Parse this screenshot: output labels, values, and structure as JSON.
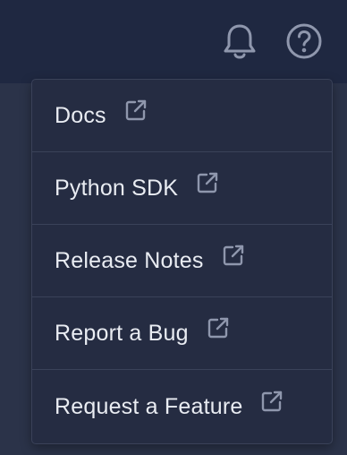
{
  "header": {
    "notifications_icon": "bell-icon",
    "help_icon": "help-circle-icon"
  },
  "colors": {
    "topbar": "#1f2841",
    "menu_bg": "#252c42",
    "menu_border": "#3a4259",
    "text": "#e9ecf2",
    "icon": "#8f97ad"
  },
  "help_menu": {
    "items": [
      {
        "label": "Docs",
        "icon": "external-link-icon"
      },
      {
        "label": "Python SDK",
        "icon": "external-link-icon"
      },
      {
        "label": "Release Notes",
        "icon": "external-link-icon"
      },
      {
        "label": "Report a Bug",
        "icon": "external-link-icon"
      },
      {
        "label": "Request a Feature",
        "icon": "external-link-icon"
      }
    ]
  }
}
